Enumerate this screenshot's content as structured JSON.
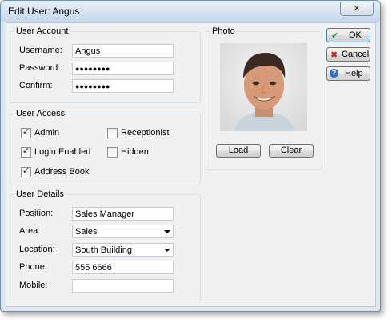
{
  "window": {
    "title": "Edit User: Angus",
    "close_glyph": "✕"
  },
  "user_account": {
    "legend": "User Account",
    "username_label": "Username:",
    "username_value": "Angus",
    "password_label": "Password:",
    "password_value": "●●●●●●●●",
    "confirm_label": "Confirm:",
    "confirm_value": "●●●●●●●●"
  },
  "user_access": {
    "legend": "User Access",
    "checkboxes": [
      {
        "label": "Admin",
        "checked": true
      },
      {
        "label": "Receptionist",
        "checked": false
      },
      {
        "label": "Login Enabled",
        "checked": true
      },
      {
        "label": "Hidden",
        "checked": false
      },
      {
        "label": "Address Book",
        "checked": true
      }
    ]
  },
  "user_details": {
    "legend": "User Details",
    "position_label": "Position:",
    "position_value": "Sales Manager",
    "area_label": "Area:",
    "area_value": "Sales",
    "location_label": "Location:",
    "location_value": "South Building",
    "phone_label": "Phone:",
    "phone_value": "555 6666",
    "mobile_label": "Mobile:",
    "mobile_value": ""
  },
  "photo": {
    "legend": "Photo",
    "load_label": "Load",
    "clear_label": "Clear"
  },
  "buttons": {
    "ok_label": "OK",
    "cancel_label": "Cancel",
    "help_label": "Help"
  },
  "colors": {
    "ok_icon": "#2e9b2e",
    "cancel_icon": "#d02020",
    "help_icon": "#2a6fc4"
  }
}
